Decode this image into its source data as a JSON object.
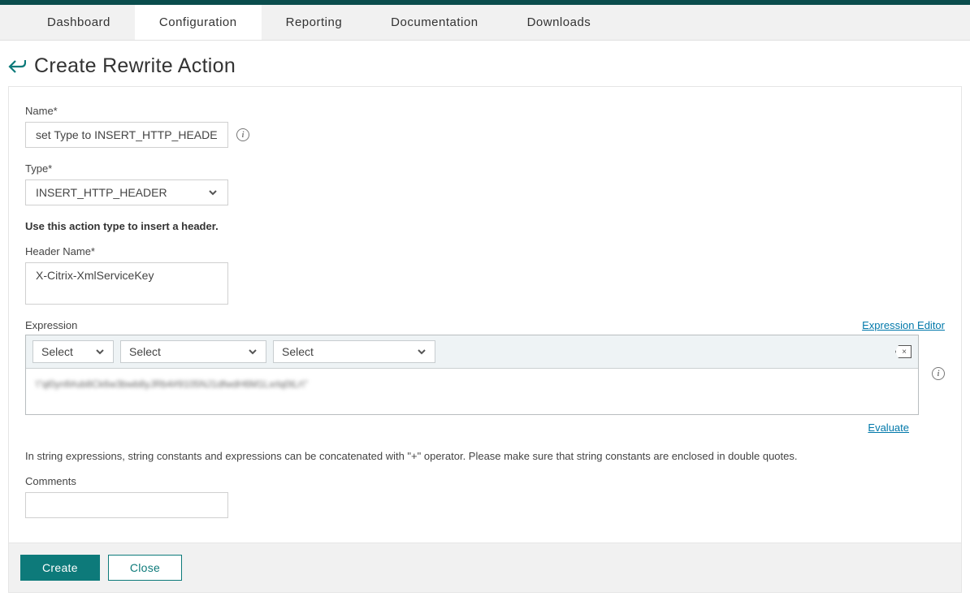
{
  "nav": {
    "items": [
      {
        "label": "Dashboard"
      },
      {
        "label": "Configuration"
      },
      {
        "label": "Reporting"
      },
      {
        "label": "Documentation"
      },
      {
        "label": "Downloads"
      }
    ]
  },
  "page": {
    "title": "Create Rewrite Action"
  },
  "form": {
    "name_label": "Name*",
    "name_value": "set Type to INSERT_HTTP_HEADER",
    "type_label": "Type*",
    "type_value": "INSERT_HTTP_HEADER",
    "type_hint": "Use this action type to insert a header.",
    "header_label": "Header Name*",
    "header_value": "X-Citrix-XmlServiceKey",
    "expr_label": "Expression",
    "expr_editor_link": "Expression Editor",
    "expr_selects": [
      "Select",
      "Select",
      "Select"
    ],
    "expr_value": "\\\"ql0ynfi#ub8Ck6w3bwb8yJRb4#9105NJ1dfwdH6M1Lxrlq0tLr\\\"",
    "evaluate_link": "Evaluate",
    "expr_hint": "In string expressions, string constants and expressions can be concatenated with \"+\" operator. Please make sure that string constants are enclosed in double quotes.",
    "comments_label": "Comments"
  },
  "footer": {
    "create": "Create",
    "close": "Close"
  }
}
